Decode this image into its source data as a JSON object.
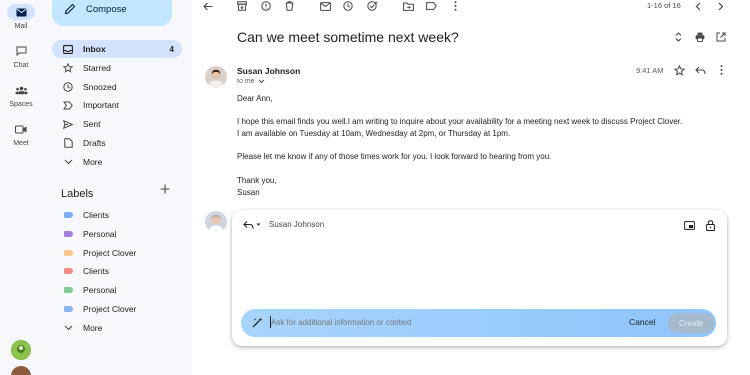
{
  "rail": {
    "items": [
      {
        "label": "Mail",
        "icon": "mail-icon"
      },
      {
        "label": "Chat",
        "icon": "chat-icon"
      },
      {
        "label": "Spaces",
        "icon": "spaces-icon"
      },
      {
        "label": "Meet",
        "icon": "meet-icon"
      }
    ]
  },
  "nav": {
    "compose_label": "Compose",
    "folders": [
      {
        "label": "Inbox",
        "count": "4",
        "icon": "inbox-icon"
      },
      {
        "label": "Starred",
        "icon": "star-icon"
      },
      {
        "label": "Snoozed",
        "icon": "clock-icon"
      },
      {
        "label": "Important",
        "icon": "important-icon"
      },
      {
        "label": "Sent",
        "icon": "send-icon"
      },
      {
        "label": "Drafts",
        "icon": "draft-icon"
      },
      {
        "label": "More",
        "icon": "chevron-down-icon"
      }
    ],
    "labels_heading": "Labels",
    "labels": [
      {
        "label": "Clients",
        "color": "#7cacf8"
      },
      {
        "label": "Personal",
        "color": "#a57fe0"
      },
      {
        "label": "Project Clover",
        "color": "#fbc88a"
      },
      {
        "label": "Clients",
        "color": "#f28b82"
      },
      {
        "label": "Personal",
        "color": "#81c995"
      },
      {
        "label": "Project Clover",
        "color": "#8ab4f8"
      }
    ],
    "labels_more": "More"
  },
  "toolbar": {
    "pager": "1-16 of 16"
  },
  "email": {
    "subject": "Can we meet sometime next week?",
    "sender": "Susan Johnson",
    "recipient": "to me",
    "time": "9:41 AM",
    "body": [
      "Dear Ann,",
      "I hope this email finds you well.I am writing to inquire about your availability for a meeting next week to discuss Project Clover.",
      "I am available on Tuesday at 10am, Wednesday at 2pm, or Thursday at 1pm.",
      "Please let me know if any of those times work for you. I look forward to hearing from you.",
      "Thank you,",
      "Susan"
    ]
  },
  "reply": {
    "recipient": "Susan Johnson",
    "ai_placeholder": "Ask for additional information or context",
    "cancel_label": "Cancel",
    "create_label": "Create"
  },
  "colors": {
    "accent": "#c2e7ff",
    "active": "#d3e3fd"
  }
}
